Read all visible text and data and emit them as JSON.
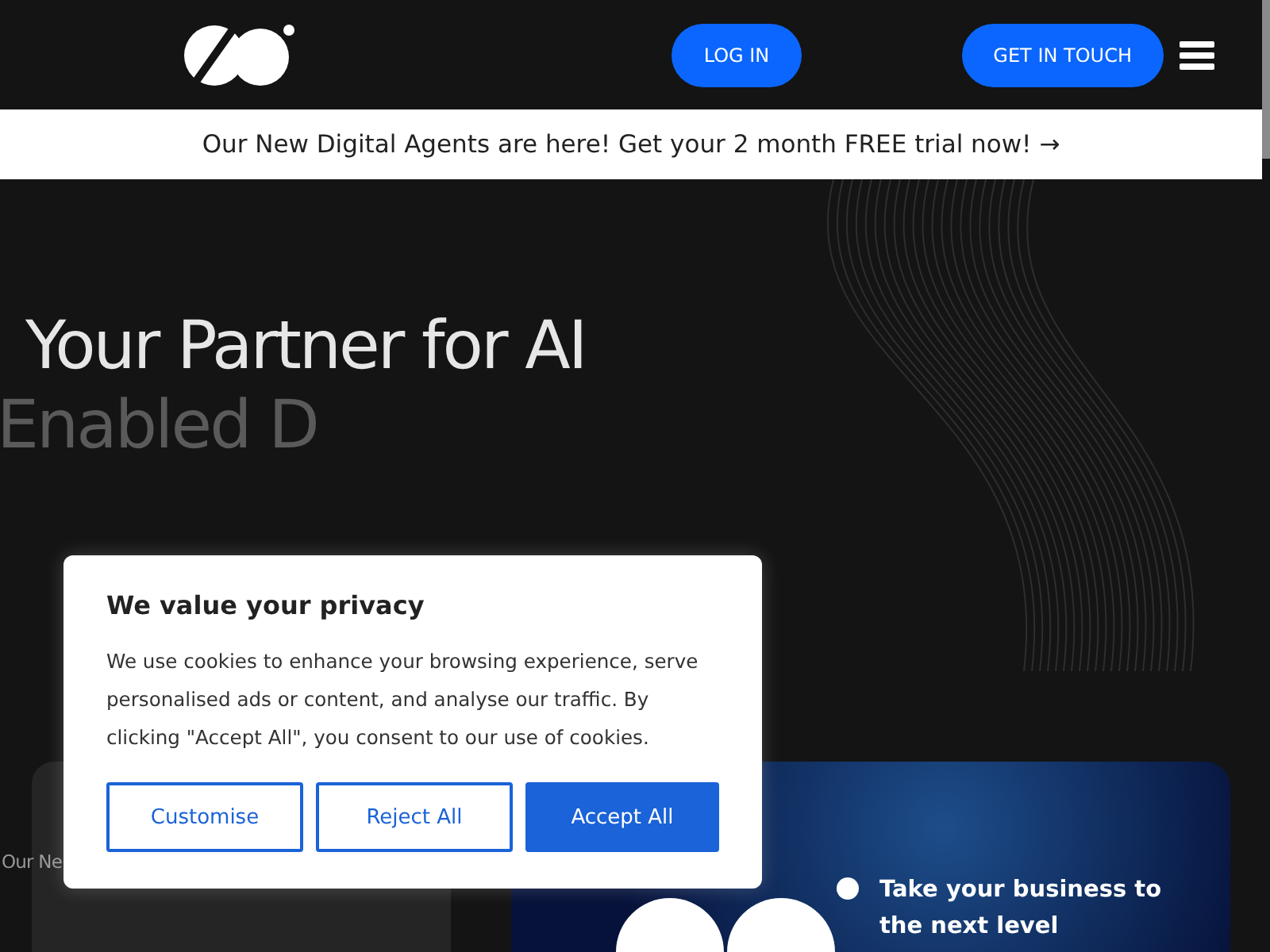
{
  "header": {
    "buttons": [
      {
        "label": "LOG IN",
        "kind": "login"
      },
      {
        "label": "GET IN TOUCH",
        "kind": "contact"
      }
    ]
  },
  "announcement": {
    "text": "Our New Digital Agents are here! Get your 2 month FREE trial now!",
    "arrow": "→"
  },
  "hero": {
    "title_lines": [
      "Your Partner for AI",
      "Enabled D"
    ]
  },
  "cards": [
    {
      "kind": "plain",
      "text": "Our Ne"
    },
    {
      "kind": "promo",
      "text": "Take your business to the next level"
    }
  ],
  "cookie_dialog": {
    "title": "We value your privacy",
    "body": "We use cookies to enhance your browsing experience, serve personalised ads or content, and analyse our traffic. By clicking \"Accept All\", you consent to our use of cookies.",
    "buttons": [
      {
        "label": "Customise",
        "kind": "outline"
      },
      {
        "label": "Reject All",
        "kind": "outline"
      },
      {
        "label": "Accept All",
        "kind": "primary"
      }
    ]
  }
}
